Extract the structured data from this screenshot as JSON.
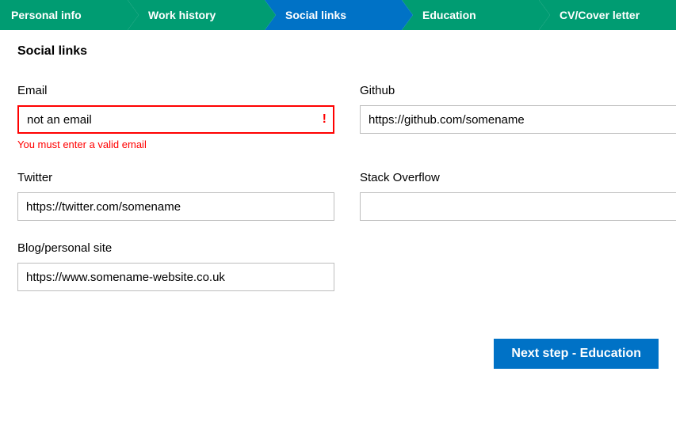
{
  "steps": [
    {
      "label": "Personal info",
      "active": false
    },
    {
      "label": "Work history",
      "active": false
    },
    {
      "label": "Social links",
      "active": true
    },
    {
      "label": "Education",
      "active": false
    },
    {
      "label": "CV/Cover letter",
      "active": false
    }
  ],
  "page_title": "Social links",
  "fields": {
    "email": {
      "label": "Email",
      "value": "not an email",
      "error": "You must enter a valid email",
      "error_icon": "!"
    },
    "github": {
      "label": "Github",
      "value": "https://github.com/somename"
    },
    "twitter": {
      "label": "Twitter",
      "value": "https://twitter.com/somename"
    },
    "stackoverflow": {
      "label": "Stack Overflow",
      "value": ""
    },
    "blog": {
      "label": "Blog/personal site",
      "value": "https://www.somename-website.co.uk"
    }
  },
  "next_button": "Next step - Education"
}
